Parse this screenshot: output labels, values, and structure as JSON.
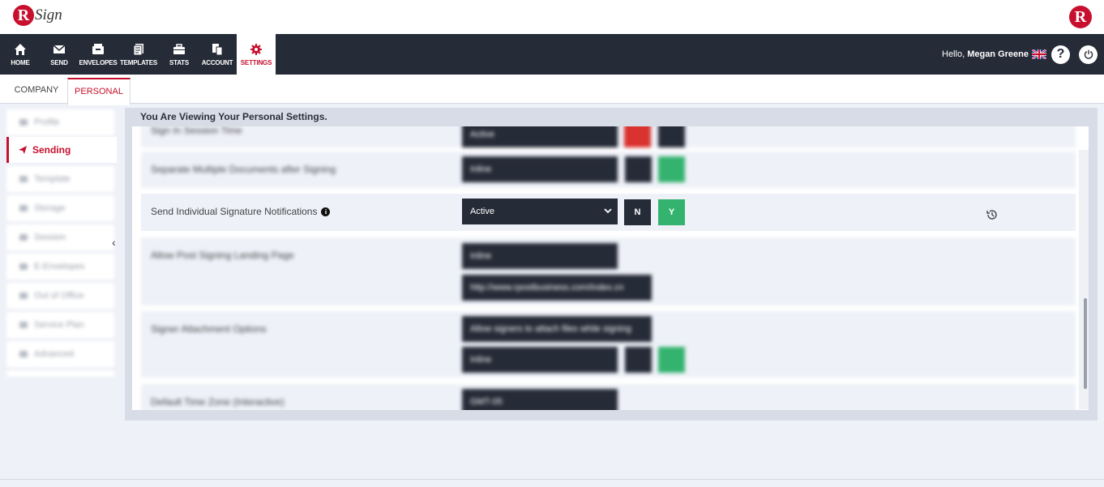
{
  "brand": {
    "logo_letter": "R",
    "logo_text": "Sign",
    "color": "#c8102e"
  },
  "nav": {
    "items": [
      {
        "label": "HOME",
        "icon": "home-icon"
      },
      {
        "label": "SEND",
        "icon": "envelope-icon"
      },
      {
        "label": "ENVELOPES",
        "icon": "envelopes-icon"
      },
      {
        "label": "TEMPLATES",
        "icon": "templates-icon"
      },
      {
        "label": "STATS",
        "icon": "briefcase-icon"
      },
      {
        "label": "ACCOUNT",
        "icon": "account-icon"
      },
      {
        "label": "SETTINGS",
        "icon": "gear-icon",
        "active": true
      }
    ],
    "hello_prefix": "Hello,",
    "user_name": "Megan Greene",
    "help_label": "?",
    "bg": "#252b37"
  },
  "tabs": [
    {
      "label": "COMPANY"
    },
    {
      "label": "PERSONAL",
      "active": true
    }
  ],
  "sidebar": {
    "items": [
      {
        "label": "Profile"
      },
      {
        "label": "Sending",
        "active": true
      },
      {
        "label": "Template"
      },
      {
        "label": "Storage"
      },
      {
        "label": "Session"
      },
      {
        "label": "E-Envelopes"
      },
      {
        "label": "Out of Office"
      },
      {
        "label": "Service Plan"
      },
      {
        "label": "Advanced"
      }
    ]
  },
  "panel": {
    "title": "You Are Viewing Your Personal Settings."
  },
  "rows": {
    "focused": {
      "label": "Send Individual Signature Notifications",
      "info": "i",
      "select_value": "Active",
      "n_label": "N",
      "y_label": "Y"
    },
    "blurred": [
      {
        "label": "Sign In Session Time",
        "value": "Active"
      },
      {
        "label": "Separate Multiple Documents after Signing",
        "value": "Inline"
      },
      {
        "label": "Allow Post Signing Landing Page",
        "value": "Inline",
        "value2": "http://www.rpostbusiness.com/index.cn"
      },
      {
        "label": "Signer Attachment Options",
        "value": "Allow signers to attach files while signing",
        "value2": "Inline"
      },
      {
        "label": "Default Time Zone (Interactive)",
        "value": "GMT-05"
      }
    ]
  }
}
